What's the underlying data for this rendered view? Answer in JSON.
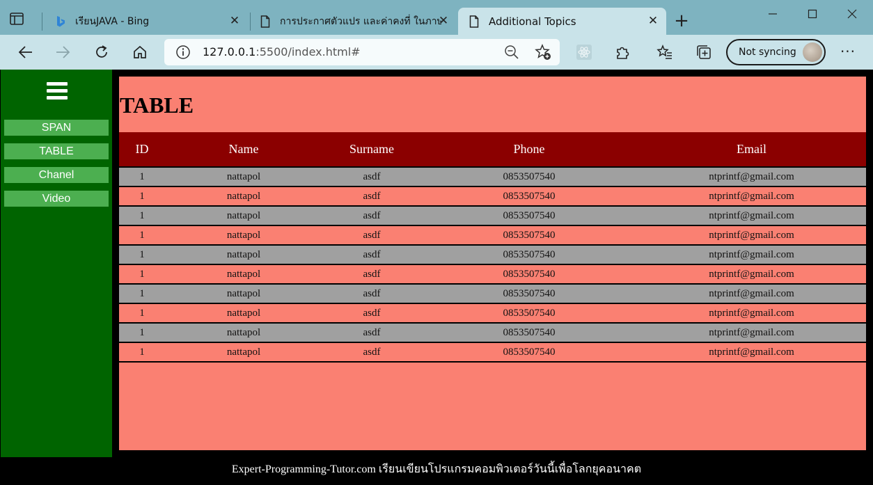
{
  "browser": {
    "tabs": [
      {
        "title": "เรียนJAVA - Bing",
        "active": false,
        "icon": "bing-icon"
      },
      {
        "title": "การประกาศตัวแปร และค่าคงที่ ในภาษา",
        "active": false,
        "icon": "page-icon"
      },
      {
        "title": "Additional Topics",
        "active": true,
        "icon": "page-icon"
      }
    ],
    "address": {
      "host": "127.0.0.1",
      "rest": ":5500/index.html#"
    },
    "sync_label": "Not syncing"
  },
  "sidebar": {
    "menu_icon": "hamburger-icon",
    "items": [
      {
        "label": "SPAN"
      },
      {
        "label": "TABLE"
      },
      {
        "label": "Chanel"
      },
      {
        "label": "Video"
      }
    ]
  },
  "main": {
    "title": "TABLE",
    "table": {
      "headers": [
        "ID",
        "Name",
        "Surname",
        "Phone",
        "Email"
      ],
      "rows": [
        [
          "1",
          "nattapol",
          "asdf",
          "0853507540",
          "ntprintf@gmail.com"
        ],
        [
          "1",
          "nattapol",
          "asdf",
          "0853507540",
          "ntprintf@gmail.com"
        ],
        [
          "1",
          "nattapol",
          "asdf",
          "0853507540",
          "ntprintf@gmail.com"
        ],
        [
          "1",
          "nattapol",
          "asdf",
          "0853507540",
          "ntprintf@gmail.com"
        ],
        [
          "1",
          "nattapol",
          "asdf",
          "0853507540",
          "ntprintf@gmail.com"
        ],
        [
          "1",
          "nattapol",
          "asdf",
          "0853507540",
          "ntprintf@gmail.com"
        ],
        [
          "1",
          "nattapol",
          "asdf",
          "0853507540",
          "ntprintf@gmail.com"
        ],
        [
          "1",
          "nattapol",
          "asdf",
          "0853507540",
          "ntprintf@gmail.com"
        ],
        [
          "1",
          "nattapol",
          "asdf",
          "0853507540",
          "ntprintf@gmail.com"
        ],
        [
          "1",
          "nattapol",
          "asdf",
          "0853507540",
          "ntprintf@gmail.com"
        ]
      ]
    }
  },
  "footer": {
    "text": "Expert-Programming-Tutor.com เรียนเขียนโปรแกรมคอมพิวเตอร์วันนี้เพื่อโลกยุคอนาคต"
  },
  "colors": {
    "sidebar_bg": "#006400",
    "sidebar_button": "#4caf50",
    "content_bg": "#fa8072",
    "header_bg": "#8b0000",
    "row_alt": "#a0a0a0",
    "browser_frame": "#7eb3c0",
    "browser_toolbar": "#c9e3e9"
  }
}
